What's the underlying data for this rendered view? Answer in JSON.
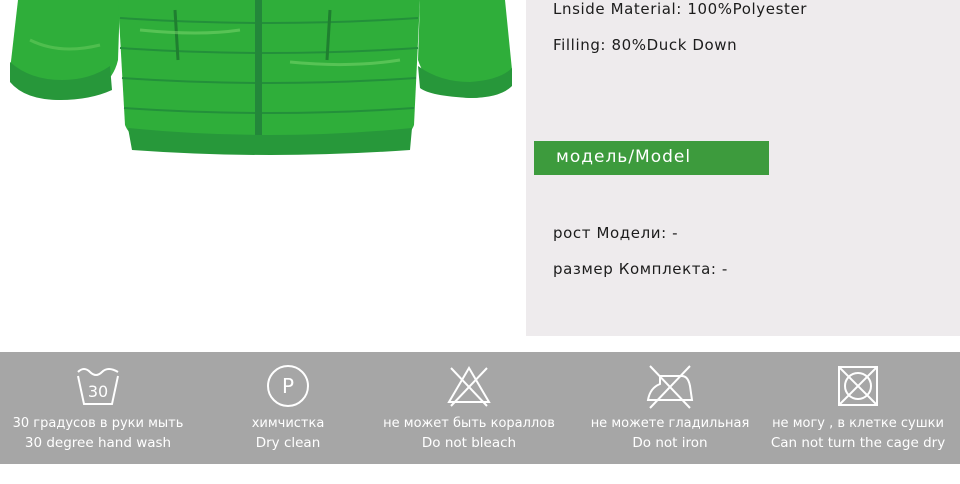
{
  "specs": {
    "inside_material": "Lnside Material: 100%Polyester",
    "filling": "Filling: 80%Duck Down"
  },
  "model": {
    "banner": "модель/Model",
    "height": "рост Модели: -",
    "set_size": "размер Комплекта: -"
  },
  "care": [
    {
      "icon": "hand-wash-30-icon",
      "ru": "30 градусов  в руки мыть",
      "en": "30 degree hand wash",
      "symbol": "30"
    },
    {
      "icon": "dry-clean-icon",
      "ru": "химчистка",
      "en": "Dry clean",
      "symbol": "P"
    },
    {
      "icon": "no-bleach-icon",
      "ru": "не  может быть  кораллов",
      "en": "Do not bleach"
    },
    {
      "icon": "no-iron-icon",
      "ru": "не  можете  гладильная",
      "en": "Do not iron"
    },
    {
      "icon": "no-tumble-dry-icon",
      "ru": "не  могу  , в клетке  сушки",
      "en": "Can not turn the cage dry"
    }
  ],
  "colors": {
    "jacket": "#2fae3a",
    "banner": "#3d9b3d",
    "panel": "#eeebed",
    "care_bar": "#a6a6a6"
  }
}
